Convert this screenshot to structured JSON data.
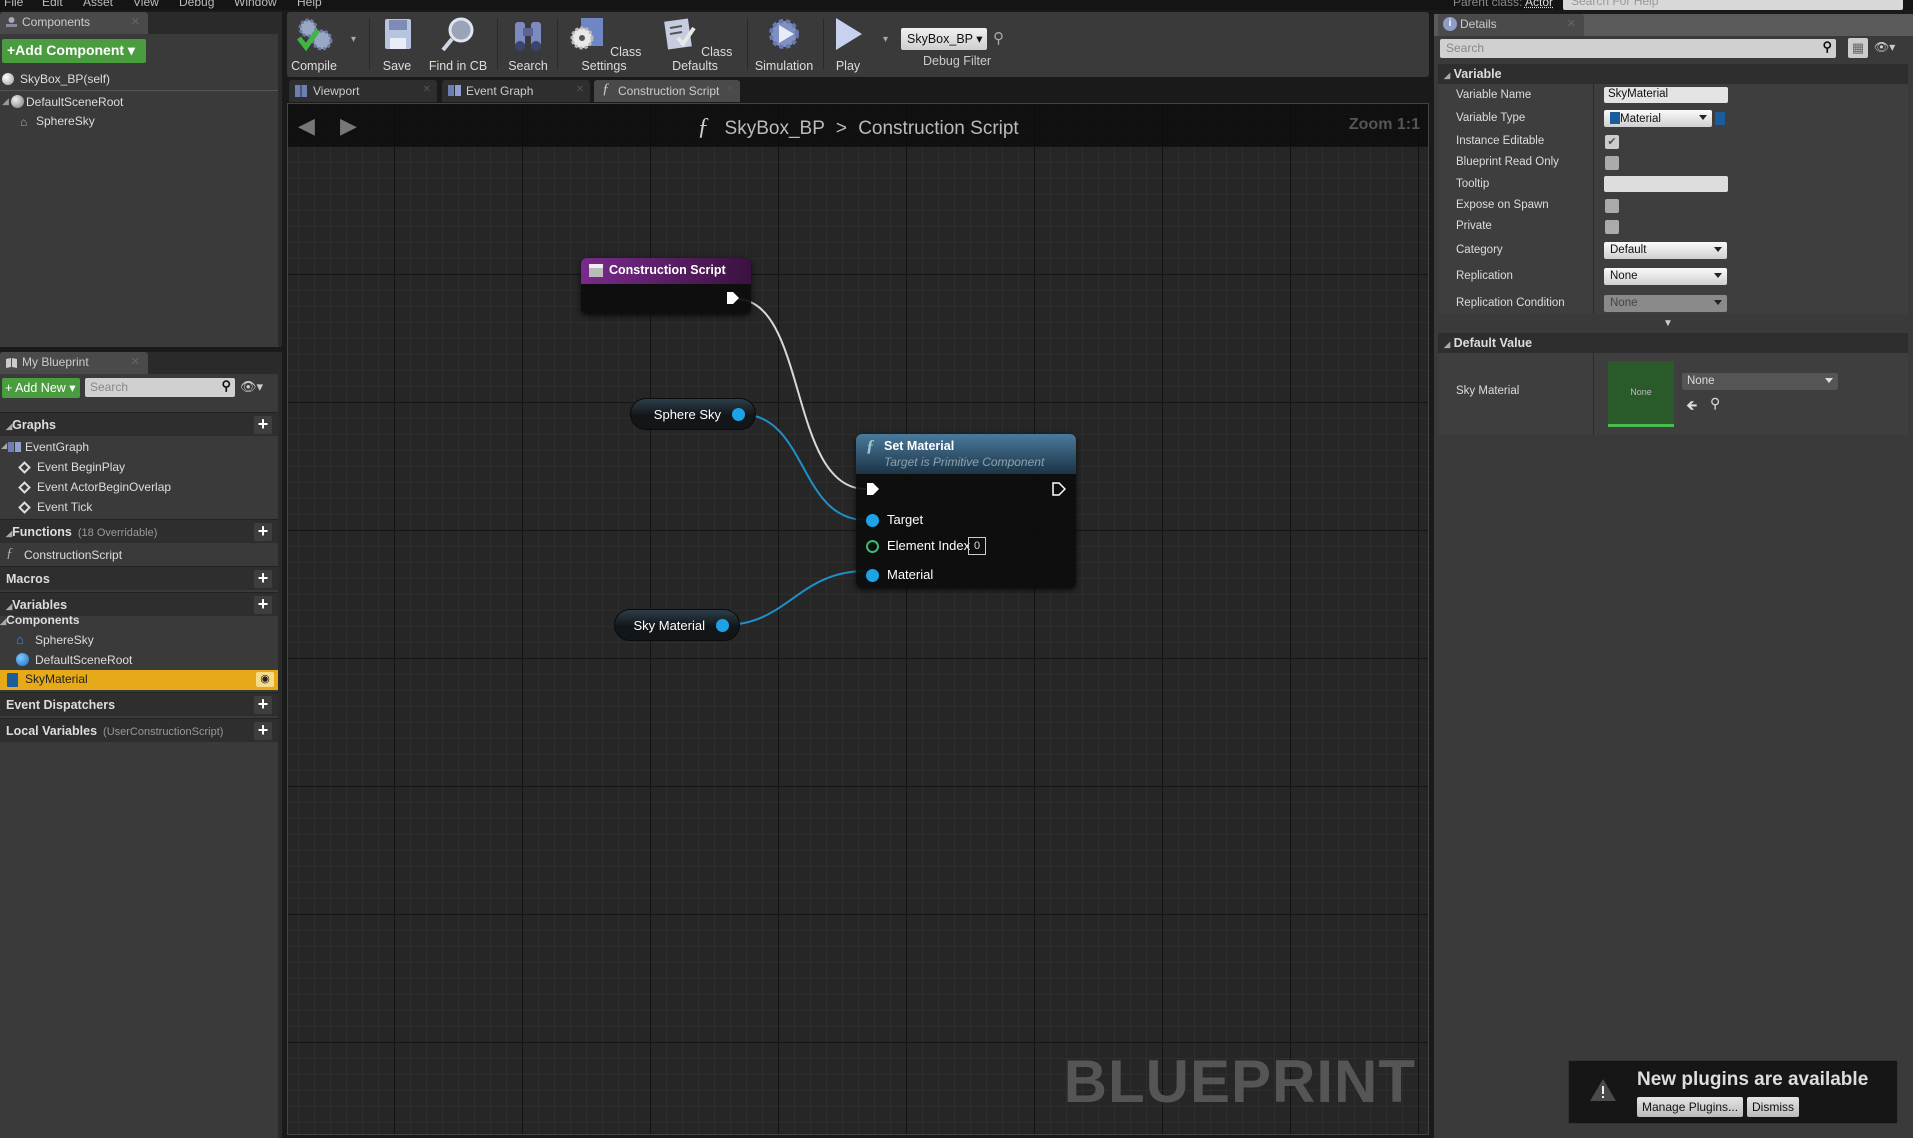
{
  "menu": [
    "File",
    "Edit",
    "Asset",
    "View",
    "Debug",
    "Window",
    "Help"
  ],
  "header": {
    "parent_class_label": "Parent class:",
    "parent_class_value": "Actor",
    "help_search_placeholder": "Search For Help"
  },
  "components_panel": {
    "tab_label": "Components",
    "add_button": "+Add Component",
    "self_item": "SkyBox_BP(self)",
    "tree": [
      {
        "label": "DefaultSceneRoot",
        "icon": "scene-root-icon"
      },
      {
        "label": "SphereSky",
        "icon": "static-mesh-icon"
      }
    ]
  },
  "toolbar": {
    "buttons": [
      {
        "label": "Compile",
        "icon": "compile-gear-check-icon"
      },
      {
        "label": "Save",
        "icon": "floppy-disk-icon"
      },
      {
        "label": "Find in CB",
        "icon": "magnifier-icon"
      },
      {
        "label": "Search",
        "icon": "binoculars-icon"
      },
      {
        "label": "Class Settings",
        "icon": "class-settings-gear-icon"
      },
      {
        "label": "Class Defaults",
        "icon": "class-defaults-checklist-icon"
      },
      {
        "label": "Simulation",
        "icon": "simulation-icon"
      },
      {
        "label": "Play",
        "icon": "play-icon"
      }
    ],
    "debug_object": "SkyBox_BP",
    "debug_filter_label": "Debug Filter"
  },
  "doc_tabs": [
    {
      "label": "Viewport",
      "active": false
    },
    {
      "label": "Event Graph",
      "active": false
    },
    {
      "label": "Construction Script",
      "active": true
    }
  ],
  "graph": {
    "breadcrumb_root": "SkyBox_BP",
    "breadcrumb_separator": ">",
    "breadcrumb_current": "Construction Script",
    "zoom_label": "Zoom 1:1",
    "watermark": "BLUEPRINT",
    "nodes": {
      "construction_script": {
        "title": "Construction Script",
        "color": "#6a1a7a"
      },
      "sphere_sky": {
        "label": "Sphere Sky"
      },
      "sky_material": {
        "label": "Sky Material"
      },
      "set_material": {
        "title": "Set Material",
        "subtitle": "Target is Primitive Component",
        "pins": {
          "target": "Target",
          "element_index": "Element Index",
          "element_index_value": "0",
          "material": "Material"
        }
      }
    }
  },
  "my_blueprint": {
    "tab_label": "My Blueprint",
    "add_new": "+ Add New",
    "search_placeholder": "Search",
    "sections": {
      "graphs": "Graphs",
      "event_graph": "EventGraph",
      "events": [
        "Event BeginPlay",
        "Event ActorBeginOverlap",
        "Event Tick"
      ],
      "functions": "Functions",
      "functions_sub": "(18 Overridable)",
      "construction_script": "ConstructionScript",
      "macros": "Macros",
      "variables": "Variables",
      "components": "Components",
      "component_vars": [
        "SphereSky",
        "DefaultSceneRoot"
      ],
      "selected_var": "SkyMaterial",
      "event_dispatchers": "Event Dispatchers",
      "local_variables": "Local Variables",
      "local_variables_sub": "(UserConstructionScript)"
    }
  },
  "details": {
    "tab_label": "Details",
    "search_placeholder": "Search",
    "variable_section": "Variable",
    "fields": {
      "variable_name": {
        "label": "Variable Name",
        "value": "SkyMaterial"
      },
      "variable_type": {
        "label": "Variable Type",
        "value": "Material"
      },
      "instance_editable": {
        "label": "Instance Editable",
        "checked": true
      },
      "blueprint_read_only": {
        "label": "Blueprint Read Only",
        "checked": false
      },
      "tooltip": {
        "label": "Tooltip",
        "value": ""
      },
      "expose_on_spawn": {
        "label": "Expose on Spawn",
        "checked": false
      },
      "private": {
        "label": "Private",
        "checked": false
      },
      "category": {
        "label": "Category",
        "value": "Default"
      },
      "replication": {
        "label": "Replication",
        "value": "None"
      },
      "replication_condition": {
        "label": "Replication Condition",
        "value": "None"
      }
    },
    "default_value_section": "Default Value",
    "default_value": {
      "label": "Sky Material",
      "thumbnail_text": "None",
      "asset_value": "None"
    }
  },
  "toast": {
    "message": "New plugins are available",
    "manage_button": "Manage Plugins...",
    "dismiss_button": "Dismiss"
  }
}
